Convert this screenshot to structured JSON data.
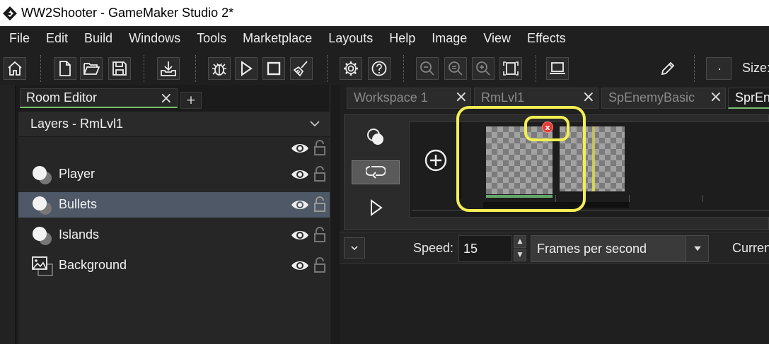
{
  "window": {
    "title": "WW2Shooter - GameMaker Studio 2*"
  },
  "menu": [
    "File",
    "Edit",
    "Build",
    "Windows",
    "Tools",
    "Marketplace",
    "Layouts",
    "Help",
    "Image",
    "View",
    "Effects"
  ],
  "toolbar": {
    "size_label": "Size:"
  },
  "room_editor": {
    "tab_label": "Room Editor",
    "add_tab": "+",
    "layers_title": "Layers - RmLvl1",
    "layers": [
      {
        "name": "Player",
        "selected": false,
        "type": "instance"
      },
      {
        "name": "Bullets",
        "selected": true,
        "type": "instance"
      },
      {
        "name": "Islands",
        "selected": false,
        "type": "instance"
      },
      {
        "name": "Background",
        "selected": false,
        "type": "background"
      }
    ]
  },
  "doc_tabs": [
    {
      "label": "Workspace 1",
      "active": false
    },
    {
      "label": "RmLvl1",
      "active": false
    },
    {
      "label": "SpEnemyBasic",
      "active": false
    },
    {
      "label": "SprEn",
      "active": true
    }
  ],
  "sprite_editor": {
    "speed_label": "Speed:",
    "speed_value": "15",
    "speed_unit": "Frames per second",
    "current_label": "Curren",
    "error_badge": "x"
  },
  "colors": {
    "accent_green": "#78c26e",
    "highlight_yellow": "#f2ee54",
    "selected_row": "#4e5866",
    "error_red": "#e53935"
  }
}
